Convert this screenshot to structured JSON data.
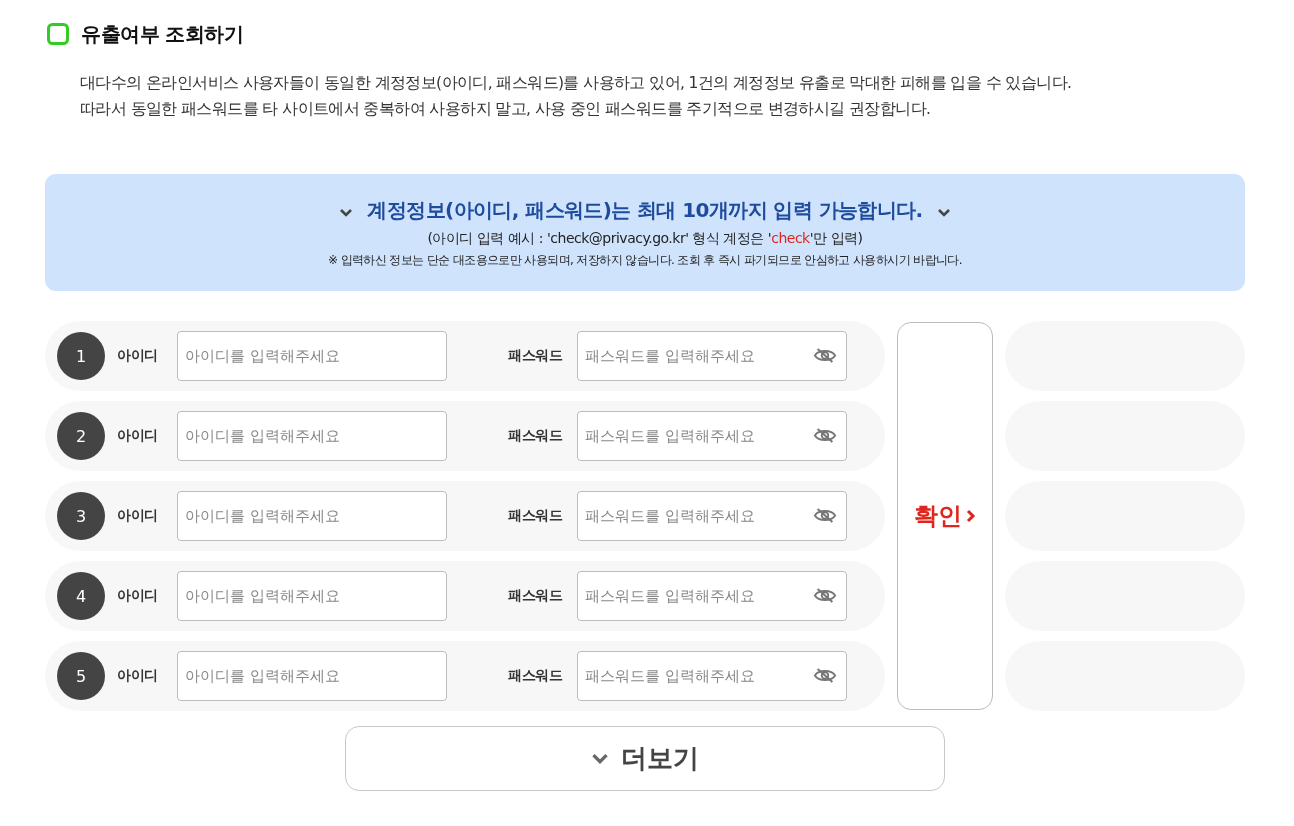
{
  "section": {
    "title": "유출여부 조회하기",
    "description": [
      "대다수의 온라인서비스 사용자들이 동일한 계정정보(아이디, 패스워드)를 사용하고 있어, 1건의 계정정보 유출로 막대한 피해를 입을 수 있습니다.",
      "따라서 동일한 패스워드를 타 사이트에서 중복하여 사용하지 말고, 사용 중인 패스워드를 주기적으로 변경하시길 권장합니다."
    ]
  },
  "notice": {
    "heading": "계정정보(아이디, 패스워드)는 최대 10개까지 입력 가능합니다.",
    "example": {
      "before": "(아이디 입력 예시 : 'check@privacy.go.kr' 형식 계정은 '",
      "highlight": "check",
      "after": "'만 입력)"
    },
    "note": "※ 입력하신 정보는 단순 대조용으로만 사용되며, 저장하지 않습니다. 조회 후 즉시 파기되므로 안심하고 사용하시기 바랍니다."
  },
  "accounts": [
    {
      "number": "1",
      "id_label": "아이디",
      "id_placeholder": "아이디를 입력해주세요",
      "password_label": "패스워드",
      "password_placeholder": "패스워드를 입력해주세요",
      "password_visible": false
    },
    {
      "number": "2",
      "id_label": "아이디",
      "id_placeholder": "아이디를 입력해주세요",
      "password_label": "패스워드",
      "password_placeholder": "패스워드를 입력해주세요",
      "password_visible": false
    },
    {
      "number": "3",
      "id_label": "아이디",
      "id_placeholder": "아이디를 입력해주세요",
      "password_label": "패스워드",
      "password_placeholder": "패스워드를 입력해주세요",
      "password_visible": false
    },
    {
      "number": "4",
      "id_label": "아이디",
      "id_placeholder": "아이디를 입력해주세요",
      "password_label": "패스워드",
      "password_placeholder": "패스워드를 입력해주세요",
      "password_visible": false
    },
    {
      "number": "5",
      "id_label": "아이디",
      "id_placeholder": "아이디를 입력해주세요",
      "password_label": "패스워드",
      "password_placeholder": "패스워드를 입력해주세요",
      "password_visible": false
    }
  ],
  "confirm_button": "확인",
  "results": [
    {
      "kind": "empty"
    },
    {
      "kind": "empty"
    },
    {
      "kind": "empty"
    },
    {
      "kind": "empty"
    },
    {
      "kind": "empty"
    }
  ],
  "more_button": "더보기"
}
